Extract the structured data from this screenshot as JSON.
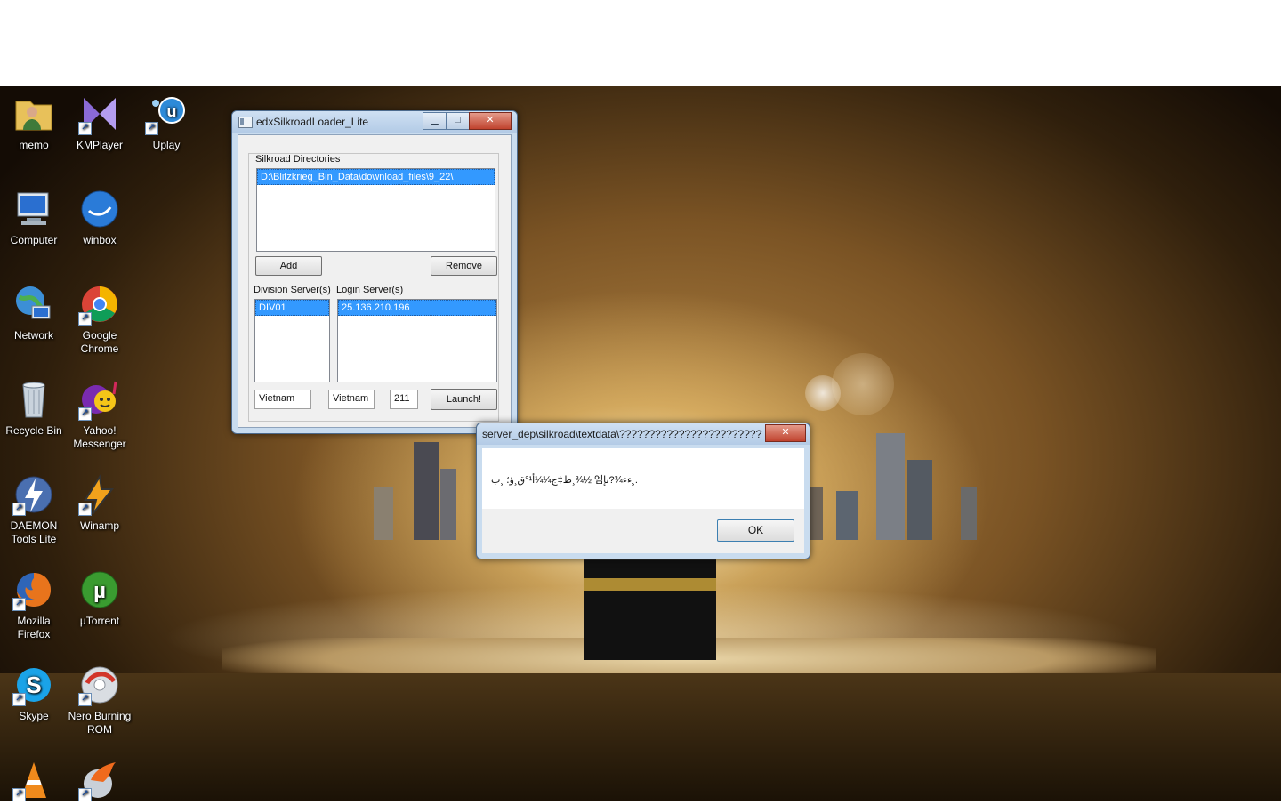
{
  "desktop": {
    "icons": [
      {
        "label": "memo"
      },
      {
        "label": "KMPlayer"
      },
      {
        "label": "Uplay"
      },
      {
        "label": "Computer"
      },
      {
        "label": "winbox"
      },
      {
        "label": "Network"
      },
      {
        "label": "Google Chrome"
      },
      {
        "label": "Recycle Bin"
      },
      {
        "label": "Yahoo! Messenger"
      },
      {
        "label": "DAEMON Tools Lite"
      },
      {
        "label": "Winamp"
      },
      {
        "label": "Mozilla Firefox"
      },
      {
        "label": "µTorrent"
      },
      {
        "label": "Skype"
      },
      {
        "label": "Nero Burning ROM"
      }
    ]
  },
  "loader_window": {
    "title": "edxSilkroadLoader_Lite",
    "directories_label": "Silkroad Directories",
    "directories": [
      "D:\\Blitzkrieg_Bin_Data\\download_files\\9_22\\"
    ],
    "add_label": "Add",
    "remove_label": "Remove",
    "division_label": "Division Server(s)",
    "division_servers": [
      "DIV01"
    ],
    "login_label": "Login Server(s)",
    "login_servers": [
      "25.136.210.196"
    ],
    "field1": "Vietnam",
    "field2": "Vietnam",
    "field3": "211",
    "launch_label": "Launch!"
  },
  "message_box": {
    "title": "server_dep\\silkroad\\textdata\\?????????????????????????????...",
    "message": "ظ‡ج¼¼أ¹°ق¸ؤ؛ ¸ب¸¾½ 엠ءء¾?ىإ¸.",
    "ok_label": "OK"
  },
  "colors": {
    "selection": "#3399ff",
    "title_bar": "#b9cfe8",
    "close_button": "#c7432d"
  }
}
